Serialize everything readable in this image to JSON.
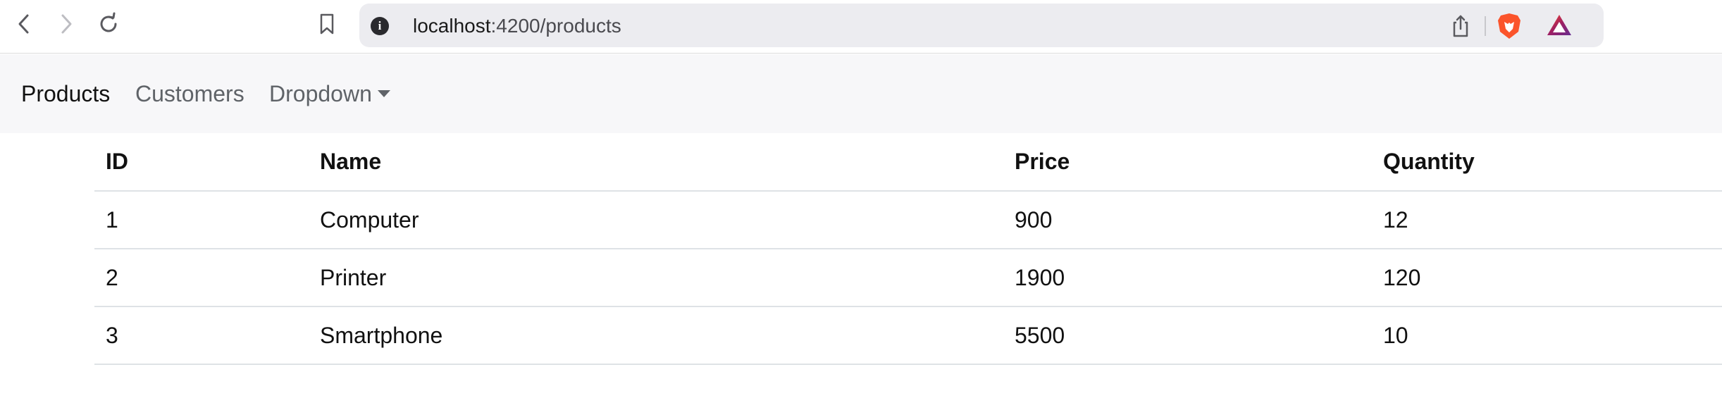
{
  "browser": {
    "url_host": "localhost",
    "url_rest": ":4200/products",
    "icons": [
      "back-icon",
      "forward-icon",
      "reload-icon",
      "bookmark-icon",
      "site-info-icon",
      "share-icon",
      "brave-shields-icon",
      "brave-rewards-icon"
    ]
  },
  "navbar": {
    "links": {
      "products": "Products",
      "customers": "Customers",
      "dropdown": "Dropdown"
    },
    "active": "Products"
  },
  "table": {
    "headers": {
      "id": "ID",
      "name": "Name",
      "price": "Price",
      "quantity": "Quantity"
    },
    "rows": [
      {
        "id": "1",
        "name": "Computer",
        "price": "900",
        "quantity": "12"
      },
      {
        "id": "2",
        "name": "Printer",
        "price": "1900",
        "quantity": "120"
      },
      {
        "id": "3",
        "name": "Smartphone",
        "price": "5500",
        "quantity": "10"
      }
    ]
  },
  "colors": {
    "navbar_bg": "#f7f7f9",
    "urlbar_bg": "#ececf0",
    "brave_orange": "#fb542b",
    "bat_purple": "#662d91"
  }
}
